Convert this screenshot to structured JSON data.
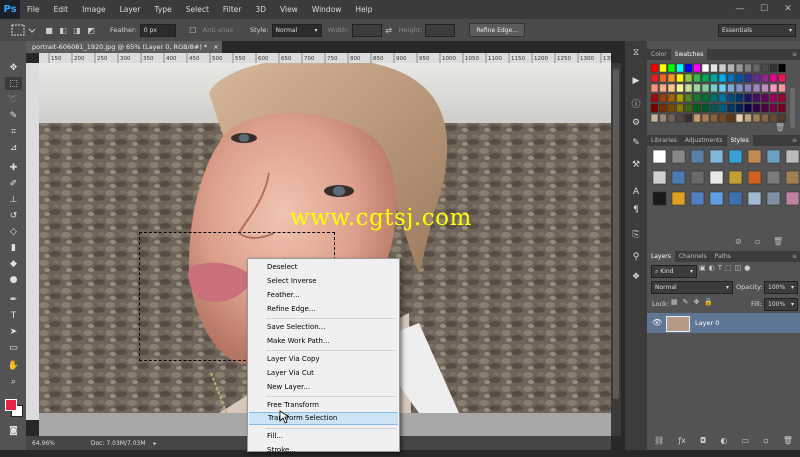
{
  "app": {
    "logo": "Ps"
  },
  "menubar": {
    "items": [
      "File",
      "Edit",
      "Image",
      "Layer",
      "Type",
      "Select",
      "Filter",
      "3D",
      "View",
      "Window",
      "Help"
    ],
    "win_controls": [
      "—",
      "☐",
      "✕"
    ]
  },
  "options": {
    "feather_label": "Feather:",
    "feather_value": "0 px",
    "antialias_label": "Anti-alias",
    "style_label": "Style:",
    "style_value": "Normal",
    "width_label": "Width:",
    "height_label": "Height:",
    "refine_label": "Refine Edge...",
    "workspace_value": "Essentials"
  },
  "document": {
    "tab_title": "portrait-606081_1920.jpg @ 65% (Layer 0, RGB/8#) *",
    "ruler_ticks": [
      "150",
      "200",
      "250",
      "300",
      "350",
      "400",
      "450",
      "500",
      "550",
      "600",
      "650",
      "700",
      "750",
      "800",
      "850",
      "900",
      "950",
      "1000",
      "1050",
      "1100",
      "1150",
      "1200",
      "1250",
      "1300",
      "1350"
    ],
    "zoom": "64.96%",
    "doc_info": "Doc: 7.03M/7.03M"
  },
  "watermark": "www.cgtsj.com",
  "context_menu": {
    "items": [
      {
        "label": "Deselect"
      },
      {
        "label": "Select Inverse"
      },
      {
        "label": "Feather..."
      },
      {
        "label": "Refine Edge..."
      },
      {
        "label": "Save Selection..."
      },
      {
        "label": "Make Work Path..."
      },
      {
        "label": "Layer Via Copy"
      },
      {
        "label": "Layer Via Cut"
      },
      {
        "label": "New Layer..."
      },
      {
        "label": "Free Transform"
      },
      {
        "label": "Transform Selection"
      },
      {
        "label": "Fill..."
      },
      {
        "label": "Stroke..."
      }
    ],
    "highlighted": "Transform Selection"
  },
  "panels": {
    "color_tabs": [
      "Color",
      "Swatches"
    ],
    "style_tabs": [
      "Libraries",
      "Adjustments",
      "Styles"
    ],
    "layer_tabs": [
      "Layers",
      "Channels",
      "Paths"
    ],
    "kind_label": "Kind",
    "blend_mode": "Normal",
    "opacity_label": "Opacity:",
    "opacity_value": "100%",
    "lock_label": "Lock:",
    "fill_label": "Fill:",
    "fill_value": "100%",
    "layer_name": "Layer 0"
  },
  "colors": {
    "foreground": "#e8244a",
    "background": "#ffffff",
    "menu_highlight": "#cde3f6",
    "watermark": "#ffff00"
  }
}
